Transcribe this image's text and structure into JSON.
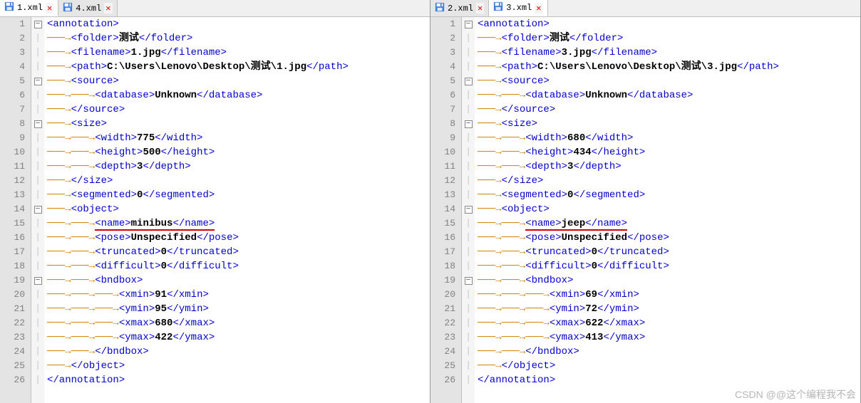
{
  "watermark": "CSDN @@这个编程我不会",
  "panes": [
    {
      "tabs": [
        {
          "label": "1.xml",
          "active": true
        },
        {
          "label": "4.xml",
          "active": false
        }
      ],
      "lines": [
        {
          "n": 1,
          "fold": "minus",
          "arrows": 0,
          "open": "<annotation>",
          "val": "",
          "close": ""
        },
        {
          "n": 2,
          "fold": "",
          "arrows": 1,
          "open": "<folder>",
          "val": "测试",
          "close": "</folder>"
        },
        {
          "n": 3,
          "fold": "",
          "arrows": 1,
          "open": "<filename>",
          "val": "1.jpg",
          "close": "</filename>"
        },
        {
          "n": 4,
          "fold": "",
          "arrows": 1,
          "open": "<path>",
          "val": "C:\\Users\\Lenovo\\Desktop\\测试\\1.jpg",
          "close": "</path>"
        },
        {
          "n": 5,
          "fold": "minus",
          "arrows": 1,
          "open": "<source>",
          "val": "",
          "close": ""
        },
        {
          "n": 6,
          "fold": "",
          "arrows": 2,
          "open": "<database>",
          "val": "Unknown",
          "close": "</database>"
        },
        {
          "n": 7,
          "fold": "",
          "arrows": 1,
          "open": "</source>",
          "val": "",
          "close": ""
        },
        {
          "n": 8,
          "fold": "minus",
          "arrows": 1,
          "open": "<size>",
          "val": "",
          "close": ""
        },
        {
          "n": 9,
          "fold": "",
          "arrows": 2,
          "open": "<width>",
          "val": "775",
          "close": "</width>"
        },
        {
          "n": 10,
          "fold": "",
          "arrows": 2,
          "open": "<height>",
          "val": "500",
          "close": "</height>"
        },
        {
          "n": 11,
          "fold": "",
          "arrows": 2,
          "open": "<depth>",
          "val": "3",
          "close": "</depth>"
        },
        {
          "n": 12,
          "fold": "",
          "arrows": 1,
          "open": "</size>",
          "val": "",
          "close": ""
        },
        {
          "n": 13,
          "fold": "",
          "arrows": 1,
          "open": "<segmented>",
          "val": "0",
          "close": "</segmented>"
        },
        {
          "n": 14,
          "fold": "minus",
          "arrows": 1,
          "open": "<object>",
          "val": "",
          "close": ""
        },
        {
          "n": 15,
          "fold": "",
          "arrows": 2,
          "open": "<name>",
          "val": "minibus",
          "close": "</name>",
          "underline": true
        },
        {
          "n": 16,
          "fold": "",
          "arrows": 2,
          "open": "<pose>",
          "val": "Unspecified",
          "close": "</pose>"
        },
        {
          "n": 17,
          "fold": "",
          "arrows": 2,
          "open": "<truncated>",
          "val": "0",
          "close": "</truncated>"
        },
        {
          "n": 18,
          "fold": "",
          "arrows": 2,
          "open": "<difficult>",
          "val": "0",
          "close": "</difficult>"
        },
        {
          "n": 19,
          "fold": "minus",
          "arrows": 2,
          "open": "<bndbox>",
          "val": "",
          "close": ""
        },
        {
          "n": 20,
          "fold": "",
          "arrows": 3,
          "open": "<xmin>",
          "val": "91",
          "close": "</xmin>"
        },
        {
          "n": 21,
          "fold": "",
          "arrows": 3,
          "open": "<ymin>",
          "val": "95",
          "close": "</ymin>"
        },
        {
          "n": 22,
          "fold": "",
          "arrows": 3,
          "open": "<xmax>",
          "val": "680",
          "close": "</xmax>"
        },
        {
          "n": 23,
          "fold": "",
          "arrows": 3,
          "open": "<ymax>",
          "val": "422",
          "close": "</ymax>"
        },
        {
          "n": 24,
          "fold": "",
          "arrows": 2,
          "open": "</bndbox>",
          "val": "",
          "close": ""
        },
        {
          "n": 25,
          "fold": "",
          "arrows": 1,
          "open": "</object>",
          "val": "",
          "close": ""
        },
        {
          "n": 26,
          "fold": "",
          "arrows": 0,
          "open": "</annotation>",
          "val": "",
          "close": ""
        }
      ]
    },
    {
      "tabs": [
        {
          "label": "2.xml",
          "active": false
        },
        {
          "label": "3.xml",
          "active": true
        }
      ],
      "lines": [
        {
          "n": 1,
          "fold": "minus",
          "arrows": 0,
          "open": "<annotation>",
          "val": "",
          "close": ""
        },
        {
          "n": 2,
          "fold": "",
          "arrows": 1,
          "open": "<folder>",
          "val": "测试",
          "close": "</folder>"
        },
        {
          "n": 3,
          "fold": "",
          "arrows": 1,
          "open": "<filename>",
          "val": "3.jpg",
          "close": "</filename>"
        },
        {
          "n": 4,
          "fold": "",
          "arrows": 1,
          "open": "<path>",
          "val": "C:\\Users\\Lenovo\\Desktop\\测试\\3.jpg",
          "close": "</path>"
        },
        {
          "n": 5,
          "fold": "minus",
          "arrows": 1,
          "open": "<source>",
          "val": "",
          "close": ""
        },
        {
          "n": 6,
          "fold": "",
          "arrows": 2,
          "open": "<database>",
          "val": "Unknown",
          "close": "</database>"
        },
        {
          "n": 7,
          "fold": "",
          "arrows": 1,
          "open": "</source>",
          "val": "",
          "close": ""
        },
        {
          "n": 8,
          "fold": "minus",
          "arrows": 1,
          "open": "<size>",
          "val": "",
          "close": ""
        },
        {
          "n": 9,
          "fold": "",
          "arrows": 2,
          "open": "<width>",
          "val": "680",
          "close": "</width>"
        },
        {
          "n": 10,
          "fold": "",
          "arrows": 2,
          "open": "<height>",
          "val": "434",
          "close": "</height>"
        },
        {
          "n": 11,
          "fold": "",
          "arrows": 2,
          "open": "<depth>",
          "val": "3",
          "close": "</depth>"
        },
        {
          "n": 12,
          "fold": "",
          "arrows": 1,
          "open": "</size>",
          "val": "",
          "close": ""
        },
        {
          "n": 13,
          "fold": "",
          "arrows": 1,
          "open": "<segmented>",
          "val": "0",
          "close": "</segmented>"
        },
        {
          "n": 14,
          "fold": "minus",
          "arrows": 1,
          "open": "<object>",
          "val": "",
          "close": ""
        },
        {
          "n": 15,
          "fold": "",
          "arrows": 2,
          "open": "<name>",
          "val": "jeep",
          "close": "</name>",
          "underline": true
        },
        {
          "n": 16,
          "fold": "",
          "arrows": 2,
          "open": "<pose>",
          "val": "Unspecified",
          "close": "</pose>"
        },
        {
          "n": 17,
          "fold": "",
          "arrows": 2,
          "open": "<truncated>",
          "val": "0",
          "close": "</truncated>"
        },
        {
          "n": 18,
          "fold": "",
          "arrows": 2,
          "open": "<difficult>",
          "val": "0",
          "close": "</difficult>"
        },
        {
          "n": 19,
          "fold": "minus",
          "arrows": 2,
          "open": "<bndbox>",
          "val": "",
          "close": ""
        },
        {
          "n": 20,
          "fold": "",
          "arrows": 3,
          "open": "<xmin>",
          "val": "69",
          "close": "</xmin>"
        },
        {
          "n": 21,
          "fold": "",
          "arrows": 3,
          "open": "<ymin>",
          "val": "72",
          "close": "</ymin>"
        },
        {
          "n": 22,
          "fold": "",
          "arrows": 3,
          "open": "<xmax>",
          "val": "622",
          "close": "</xmax>"
        },
        {
          "n": 23,
          "fold": "",
          "arrows": 3,
          "open": "<ymax>",
          "val": "413",
          "close": "</ymax>"
        },
        {
          "n": 24,
          "fold": "",
          "arrows": 2,
          "open": "</bndbox>",
          "val": "",
          "close": ""
        },
        {
          "n": 25,
          "fold": "",
          "arrows": 1,
          "open": "</object>",
          "val": "",
          "close": ""
        },
        {
          "n": 26,
          "fold": "",
          "arrows": 0,
          "open": "</annotation>",
          "val": "",
          "close": ""
        }
      ]
    }
  ]
}
